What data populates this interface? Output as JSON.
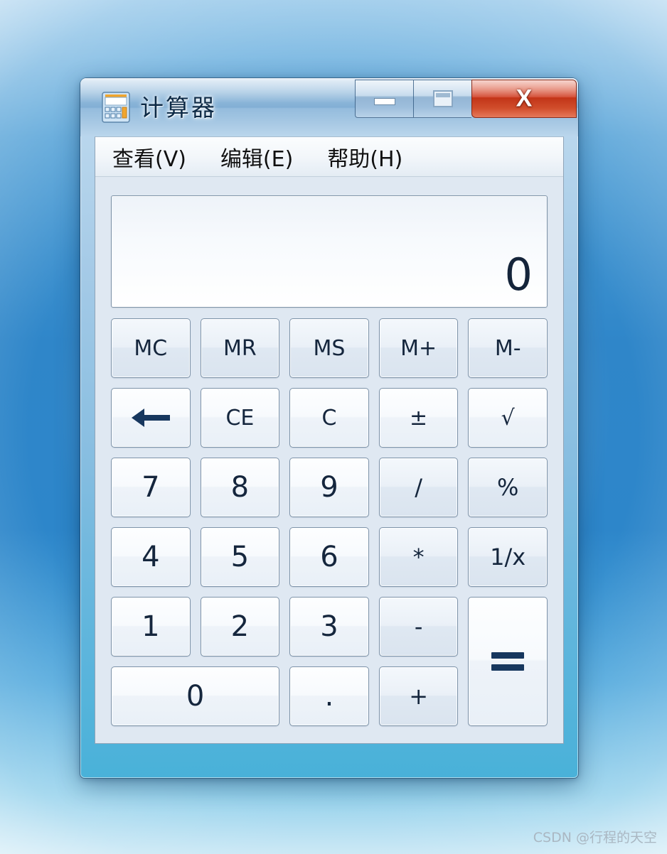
{
  "window": {
    "title": "计算器",
    "icon": "calculator-icon",
    "controls": {
      "minimize_label": "—",
      "maximize_label": "❐",
      "close_label": "X"
    }
  },
  "menu": {
    "items": [
      {
        "label": "查看(V)",
        "name": "menu-view"
      },
      {
        "label": "编辑(E)",
        "name": "menu-edit"
      },
      {
        "label": "帮助(H)",
        "name": "menu-help"
      }
    ]
  },
  "display": {
    "value": "0"
  },
  "keypad": {
    "rows": [
      [
        {
          "label": "MC",
          "name": "key-memory-clear",
          "kind": "mem"
        },
        {
          "label": "MR",
          "name": "key-memory-recall",
          "kind": "mem"
        },
        {
          "label": "MS",
          "name": "key-memory-store",
          "kind": "mem"
        },
        {
          "label": "M+",
          "name": "key-memory-add",
          "kind": "mem"
        },
        {
          "label": "M-",
          "name": "key-memory-subtract",
          "kind": "mem"
        }
      ],
      [
        {
          "label": "←",
          "name": "key-backspace",
          "kind": "fn"
        },
        {
          "label": "CE",
          "name": "key-clear-entry",
          "kind": "fn"
        },
        {
          "label": "C",
          "name": "key-clear",
          "kind": "fn"
        },
        {
          "label": "±",
          "name": "key-sign",
          "kind": "fn"
        },
        {
          "label": "√",
          "name": "key-sqrt",
          "kind": "fn"
        }
      ],
      [
        {
          "label": "7",
          "name": "key-7",
          "kind": "num"
        },
        {
          "label": "8",
          "name": "key-8",
          "kind": "num"
        },
        {
          "label": "9",
          "name": "key-9",
          "kind": "num"
        },
        {
          "label": "/",
          "name": "key-divide",
          "kind": "op"
        },
        {
          "label": "%",
          "name": "key-percent",
          "kind": "op"
        }
      ],
      [
        {
          "label": "4",
          "name": "key-4",
          "kind": "num"
        },
        {
          "label": "5",
          "name": "key-5",
          "kind": "num"
        },
        {
          "label": "6",
          "name": "key-6",
          "kind": "num"
        },
        {
          "label": "*",
          "name": "key-multiply",
          "kind": "op"
        },
        {
          "label": "1/x",
          "name": "key-reciprocal",
          "kind": "op"
        }
      ],
      [
        {
          "label": "1",
          "name": "key-1",
          "kind": "num"
        },
        {
          "label": "2",
          "name": "key-2",
          "kind": "num"
        },
        {
          "label": "3",
          "name": "key-3",
          "kind": "num"
        },
        {
          "label": "-",
          "name": "key-subtract",
          "kind": "op"
        },
        {
          "label": "=",
          "name": "key-equals",
          "kind": "equals"
        }
      ],
      [
        {
          "label": "0",
          "name": "key-0",
          "kind": "zero"
        },
        {
          "label": ".",
          "name": "key-decimal",
          "kind": "num"
        },
        {
          "label": "+",
          "name": "key-add",
          "kind": "op"
        }
      ]
    ]
  },
  "watermark": {
    "text": "CSDN @行程的天空"
  },
  "colors": {
    "titlebar_blue": "#8fb8da",
    "close_red": "#cf3b20",
    "glyph_navy": "#17375e",
    "client_bg": "#dfe8f2",
    "desktop_blue": "#2d86ca"
  }
}
